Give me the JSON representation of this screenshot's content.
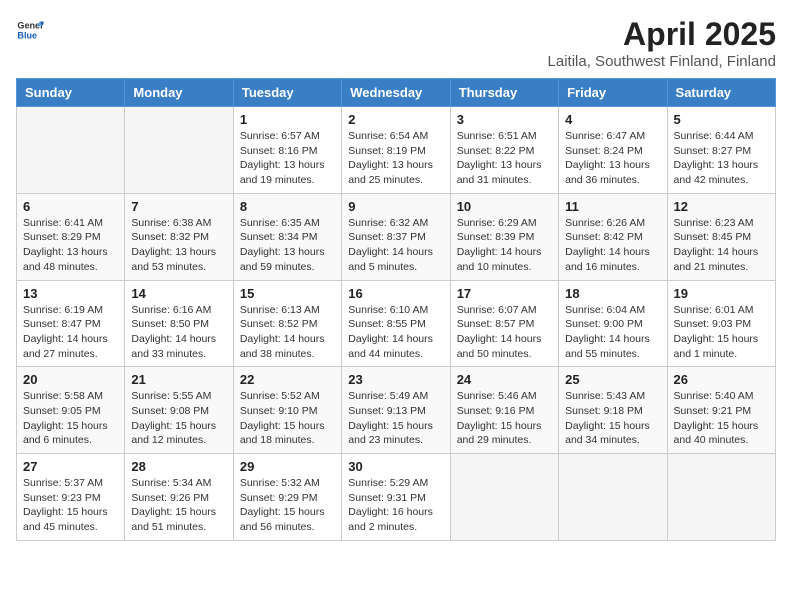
{
  "header": {
    "logo_general": "General",
    "logo_blue": "Blue",
    "title": "April 2025",
    "subtitle": "Laitila, Southwest Finland, Finland"
  },
  "calendar": {
    "days_of_week": [
      "Sunday",
      "Monday",
      "Tuesday",
      "Wednesday",
      "Thursday",
      "Friday",
      "Saturday"
    ],
    "weeks": [
      [
        {
          "day": "",
          "info": ""
        },
        {
          "day": "",
          "info": ""
        },
        {
          "day": "1",
          "info": "Sunrise: 6:57 AM\nSunset: 8:16 PM\nDaylight: 13 hours and 19 minutes."
        },
        {
          "day": "2",
          "info": "Sunrise: 6:54 AM\nSunset: 8:19 PM\nDaylight: 13 hours and 25 minutes."
        },
        {
          "day": "3",
          "info": "Sunrise: 6:51 AM\nSunset: 8:22 PM\nDaylight: 13 hours and 31 minutes."
        },
        {
          "day": "4",
          "info": "Sunrise: 6:47 AM\nSunset: 8:24 PM\nDaylight: 13 hours and 36 minutes."
        },
        {
          "day": "5",
          "info": "Sunrise: 6:44 AM\nSunset: 8:27 PM\nDaylight: 13 hours and 42 minutes."
        }
      ],
      [
        {
          "day": "6",
          "info": "Sunrise: 6:41 AM\nSunset: 8:29 PM\nDaylight: 13 hours and 48 minutes."
        },
        {
          "day": "7",
          "info": "Sunrise: 6:38 AM\nSunset: 8:32 PM\nDaylight: 13 hours and 53 minutes."
        },
        {
          "day": "8",
          "info": "Sunrise: 6:35 AM\nSunset: 8:34 PM\nDaylight: 13 hours and 59 minutes."
        },
        {
          "day": "9",
          "info": "Sunrise: 6:32 AM\nSunset: 8:37 PM\nDaylight: 14 hours and 5 minutes."
        },
        {
          "day": "10",
          "info": "Sunrise: 6:29 AM\nSunset: 8:39 PM\nDaylight: 14 hours and 10 minutes."
        },
        {
          "day": "11",
          "info": "Sunrise: 6:26 AM\nSunset: 8:42 PM\nDaylight: 14 hours and 16 minutes."
        },
        {
          "day": "12",
          "info": "Sunrise: 6:23 AM\nSunset: 8:45 PM\nDaylight: 14 hours and 21 minutes."
        }
      ],
      [
        {
          "day": "13",
          "info": "Sunrise: 6:19 AM\nSunset: 8:47 PM\nDaylight: 14 hours and 27 minutes."
        },
        {
          "day": "14",
          "info": "Sunrise: 6:16 AM\nSunset: 8:50 PM\nDaylight: 14 hours and 33 minutes."
        },
        {
          "day": "15",
          "info": "Sunrise: 6:13 AM\nSunset: 8:52 PM\nDaylight: 14 hours and 38 minutes."
        },
        {
          "day": "16",
          "info": "Sunrise: 6:10 AM\nSunset: 8:55 PM\nDaylight: 14 hours and 44 minutes."
        },
        {
          "day": "17",
          "info": "Sunrise: 6:07 AM\nSunset: 8:57 PM\nDaylight: 14 hours and 50 minutes."
        },
        {
          "day": "18",
          "info": "Sunrise: 6:04 AM\nSunset: 9:00 PM\nDaylight: 14 hours and 55 minutes."
        },
        {
          "day": "19",
          "info": "Sunrise: 6:01 AM\nSunset: 9:03 PM\nDaylight: 15 hours and 1 minute."
        }
      ],
      [
        {
          "day": "20",
          "info": "Sunrise: 5:58 AM\nSunset: 9:05 PM\nDaylight: 15 hours and 6 minutes."
        },
        {
          "day": "21",
          "info": "Sunrise: 5:55 AM\nSunset: 9:08 PM\nDaylight: 15 hours and 12 minutes."
        },
        {
          "day": "22",
          "info": "Sunrise: 5:52 AM\nSunset: 9:10 PM\nDaylight: 15 hours and 18 minutes."
        },
        {
          "day": "23",
          "info": "Sunrise: 5:49 AM\nSunset: 9:13 PM\nDaylight: 15 hours and 23 minutes."
        },
        {
          "day": "24",
          "info": "Sunrise: 5:46 AM\nSunset: 9:16 PM\nDaylight: 15 hours and 29 minutes."
        },
        {
          "day": "25",
          "info": "Sunrise: 5:43 AM\nSunset: 9:18 PM\nDaylight: 15 hours and 34 minutes."
        },
        {
          "day": "26",
          "info": "Sunrise: 5:40 AM\nSunset: 9:21 PM\nDaylight: 15 hours and 40 minutes."
        }
      ],
      [
        {
          "day": "27",
          "info": "Sunrise: 5:37 AM\nSunset: 9:23 PM\nDaylight: 15 hours and 45 minutes."
        },
        {
          "day": "28",
          "info": "Sunrise: 5:34 AM\nSunset: 9:26 PM\nDaylight: 15 hours and 51 minutes."
        },
        {
          "day": "29",
          "info": "Sunrise: 5:32 AM\nSunset: 9:29 PM\nDaylight: 15 hours and 56 minutes."
        },
        {
          "day": "30",
          "info": "Sunrise: 5:29 AM\nSunset: 9:31 PM\nDaylight: 16 hours and 2 minutes."
        },
        {
          "day": "",
          "info": ""
        },
        {
          "day": "",
          "info": ""
        },
        {
          "day": "",
          "info": ""
        }
      ]
    ]
  }
}
